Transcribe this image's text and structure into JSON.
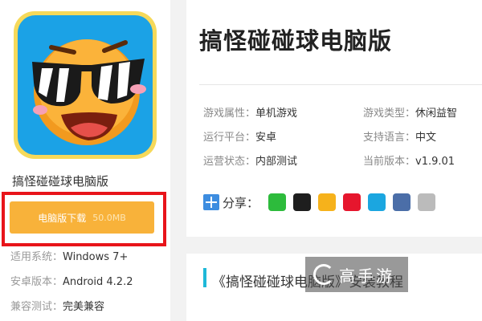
{
  "app": {
    "name": "搞怪碰碰球电脑版",
    "icon_name": "sunglasses-emoji-app-icon"
  },
  "download": {
    "label": "电脑版下载",
    "size": "50.0MB"
  },
  "specs": [
    {
      "label": "适用系统：",
      "value": "Windows 7+"
    },
    {
      "label": "安卓版本：",
      "value": "Android 4.2.2"
    },
    {
      "label": "兼容测试：",
      "value": "完美兼容"
    }
  ],
  "title": "搞怪碰碰球电脑版",
  "attributes": [
    {
      "label": "游戏属性：",
      "value": "单机游戏"
    },
    {
      "label": "游戏类型：",
      "value": "休闲益智"
    },
    {
      "label": "运行平台：",
      "value": "安卓"
    },
    {
      "label": "支持语言：",
      "value": "中文"
    },
    {
      "label": "运营状态：",
      "value": "内部测试"
    },
    {
      "label": "当前版本：",
      "value": "v1.9.01"
    }
  ],
  "share": {
    "label": "分享：",
    "icons": [
      "wechat-icon",
      "qq-icon",
      "qzone-icon",
      "weibo-icon",
      "tencent-weibo-icon",
      "print-icon",
      "copy-icon"
    ],
    "colors": [
      "#2dbb3c",
      "#1e1e1e",
      "#f6b21b",
      "#e6162d",
      "#1ba6e0",
      "#4b6ea8",
      "#bbbbbb"
    ]
  },
  "section": {
    "title": "《搞怪碰碰球电脑版》安装教程"
  },
  "watermark": {
    "text": "高手游"
  }
}
